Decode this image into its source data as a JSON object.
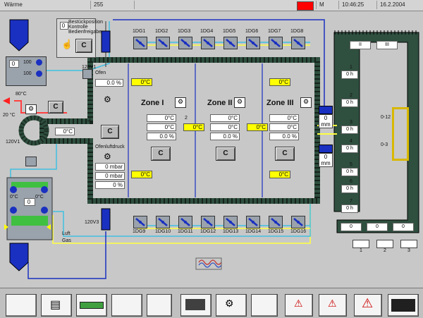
{
  "topbar": {
    "user": "Wärme",
    "field2": "255",
    "alarm_color": "#ff0000",
    "alarm_label": "M",
    "time": "10:46:25",
    "date": "16.2.2004"
  },
  "loader": {
    "title_line1": "Bestückposition",
    "title_line2": "Kontrolle",
    "title_line3": "Bedienfreigabe",
    "state_value": "0",
    "button_label": "C",
    "tag": "120V1"
  },
  "tank_top": {
    "value_main": "0",
    "value_a": "100",
    "value_b": "100"
  },
  "left_heater": {
    "temp1": "80°C",
    "temp2": "",
    "flow": "0",
    "button_label": "C",
    "ring_value": "0°C",
    "ring_value2": "0°C",
    "side_tag": "20 °C",
    "tag_small": "120V1"
  },
  "left_panel": {
    "speed_label": "Ofen",
    "speed_value": "0.0 %",
    "button_label": "C",
    "pressure_label": "Ofenluftdruck",
    "pressure_value": "0 mbar",
    "pressure2": "0 mbar",
    "pct": "0 %",
    "yellow_top": "0°C",
    "yellow_bottom": "0°C"
  },
  "zones": [
    {
      "name": "Zone I",
      "temp_set": "0°C",
      "temp_act": "0°C",
      "pct": "0.0 %",
      "button_label": "C",
      "yellow_top": "0°C",
      "side_value": "2",
      "yellow_side": "0°C"
    },
    {
      "name": "Zone II",
      "temp_set": "0°C",
      "temp_act": "0°C",
      "pct": "0.0 %",
      "button_label": "C",
      "yellow_side": "0°C"
    },
    {
      "name": "Zone III",
      "temp_set": "0°C",
      "temp_act": "0°C",
      "pct": "0.0 %",
      "button_label": "C",
      "yellow_top": "0°C",
      "yellow_bottom": "0°C"
    }
  ],
  "fans_top": [
    "1DG1",
    "1DG2",
    "1DG3",
    "1DG4",
    "1DG5",
    "1DG6",
    "1DG7",
    "1DG8"
  ],
  "fans_bottom": [
    "1DG9",
    "1DG10",
    "1DG11",
    "1DG12",
    "1DG13",
    "1DG14",
    "1DG15",
    "1DG16"
  ],
  "right_conveyor": {
    "items": [
      "1",
      "2",
      "3",
      "4",
      "5",
      "6",
      "7"
    ],
    "labels": [
      "0 h",
      "0 h",
      "0 h",
      "0 h",
      "0 h",
      "0 h",
      "0 h"
    ],
    "mm_top": "0 mm",
    "mm_bottom": "0 mm",
    "gate1": "0-12",
    "gate2": "0-3",
    "top_slots": [
      "II",
      "III"
    ],
    "bottom_slots": [
      "0",
      "0",
      "0"
    ],
    "bottom_marks": [
      "1",
      "2",
      "3"
    ]
  },
  "unloader": {
    "tag": "120V3",
    "gas_label": "Gas",
    "air_label": "Luft",
    "value": "0",
    "value2": "0°C",
    "value3": "0°C"
  },
  "bottom_bar": {
    "buttons": [
      "",
      "print-icon",
      "conveyor-icon",
      "",
      "",
      "machine-icon",
      "pressure-icon",
      "",
      "warning-list-icon",
      "warning-edit-icon",
      "warning-icon",
      "settings-icon"
    ]
  },
  "colors": {
    "oven_wall": "#2f4f3f",
    "pipe_cyan": "#40c0e0",
    "pipe_yellow": "#ffff40",
    "pipe_blue": "#1a30c0",
    "accent_yellow": "#ffff00"
  }
}
